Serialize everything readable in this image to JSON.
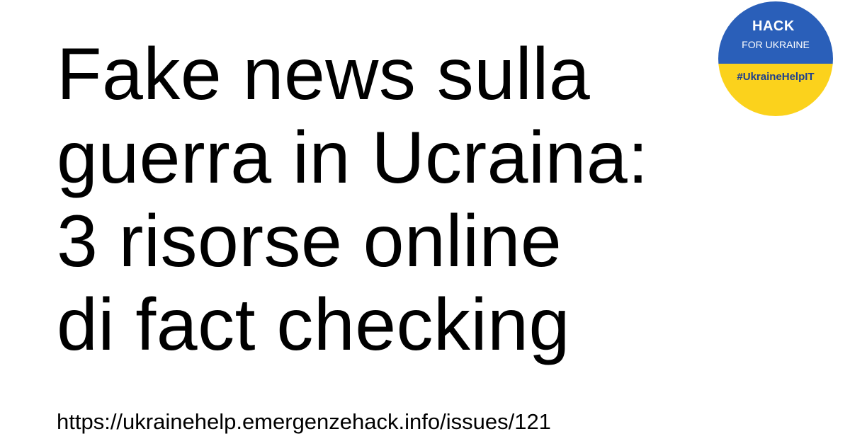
{
  "title_lines": [
    "Fake news sulla",
    "guerra in Ucraina:",
    "3 risorse online",
    "di fact checking"
  ],
  "url": "https://ukrainehelp.emergenzehack.info/issues/121",
  "badge": {
    "hack": "HACK",
    "sub": "FOR UKRAINE",
    "hashtag": "#UkraineHelpIT",
    "colors": {
      "top": "#2a5fb9",
      "bottom": "#fbd21c",
      "hashtag_text": "#1c3f8f"
    }
  }
}
